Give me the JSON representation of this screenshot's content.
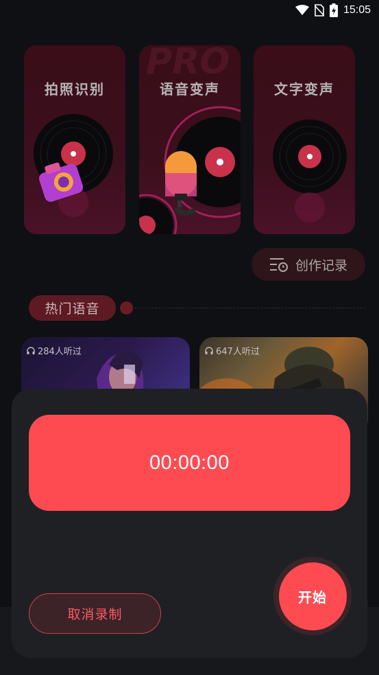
{
  "status_bar": {
    "time": "15:05",
    "icons": [
      "wifi-icon",
      "no-sim-icon",
      "battery-charging-icon"
    ]
  },
  "feature_cards": [
    {
      "title": "拍照识别",
      "icon": "camera-icon"
    },
    {
      "title": "语音变声",
      "icon": "microphone-icon",
      "watermark": "PRO"
    },
    {
      "title": "文字变声",
      "icon": "vinyl-record-icon"
    }
  ],
  "record_button": {
    "label": "创作记录",
    "icon": "list-history-icon"
  },
  "hot_section": {
    "title": "热门语音"
  },
  "voice_items": [
    {
      "listeners": "284人听过",
      "icon": "headphones-icon"
    },
    {
      "listeners": "647人听过",
      "icon": "headphones-icon"
    }
  ],
  "recorder_sheet": {
    "timer": "00:00:00",
    "cancel_label": "取消录制",
    "start_label": "开始"
  },
  "colors": {
    "accent": "#fe4b52",
    "card_bg": "#3a0d18",
    "sheet_bg": "#1f2024"
  }
}
